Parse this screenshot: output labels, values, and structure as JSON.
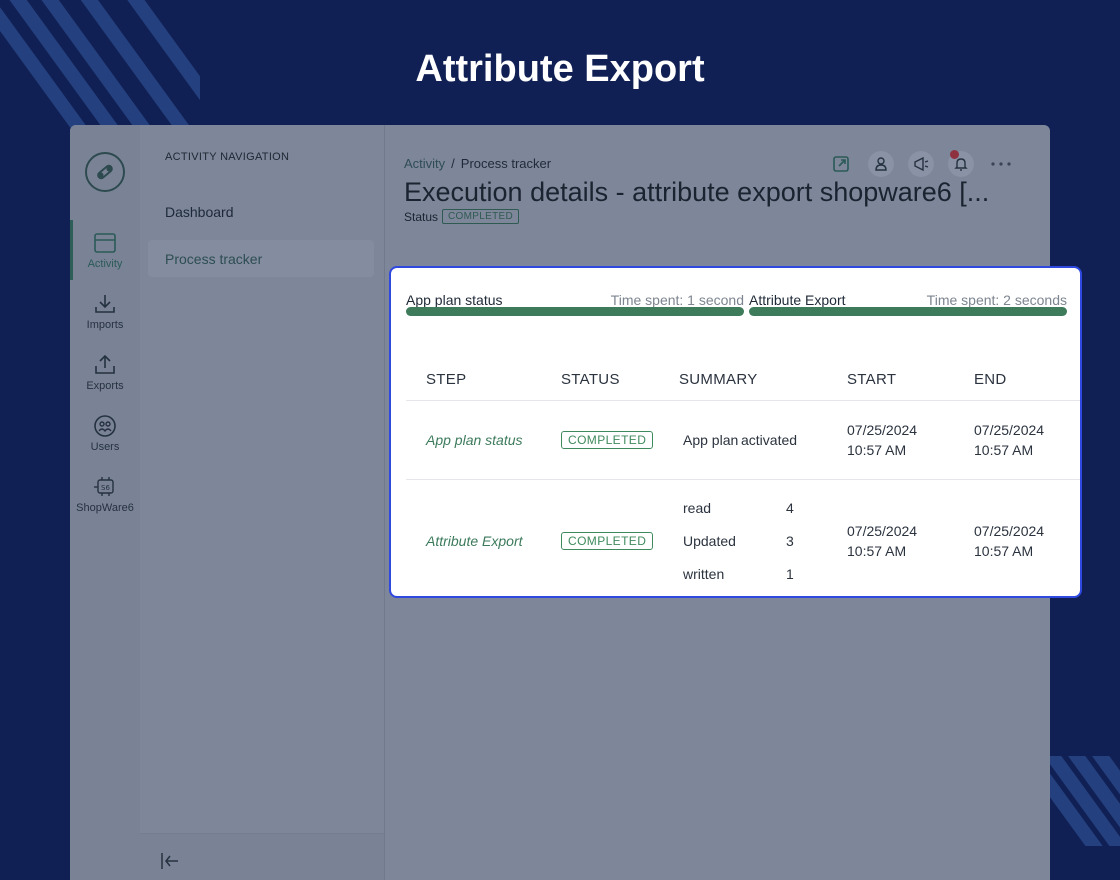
{
  "hero": {
    "title": "Attribute Export"
  },
  "rail": {
    "items": [
      {
        "label": "Activity",
        "icon": "calendar-window-icon"
      },
      {
        "label": "Imports",
        "icon": "download-icon"
      },
      {
        "label": "Exports",
        "icon": "upload-icon"
      },
      {
        "label": "Users",
        "icon": "users-icon"
      },
      {
        "label": "ShopWare6",
        "icon": "shopware-icon"
      }
    ]
  },
  "nav": {
    "heading": "ACTIVITY NAVIGATION",
    "items": [
      {
        "label": "Dashboard"
      },
      {
        "label": "Process tracker"
      }
    ]
  },
  "breadcrumb": {
    "root": "Activity",
    "separator": "/",
    "current": "Process tracker"
  },
  "page": {
    "title": "Execution details - attribute export shopware6 [...",
    "status_label": "Status",
    "status_value": "COMPLETED"
  },
  "panel": {
    "bars": [
      {
        "name": "App plan status",
        "time": "Time spent: 1 second"
      },
      {
        "name": "Attribute Export",
        "time": "Time spent: 2 seconds"
      }
    ],
    "columns": [
      "STEP",
      "STATUS",
      "SUMMARY",
      "START",
      "END"
    ],
    "rows": [
      {
        "step": "App plan status",
        "status": "COMPLETED",
        "summary_key": "App plan",
        "summary_value": "activated",
        "start_date": "07/25/2024",
        "start_time": "10:57 AM",
        "end_date": "07/25/2024",
        "end_time": "10:57 AM"
      },
      {
        "step": "Attribute Export",
        "status": "COMPLETED",
        "summary": [
          {
            "key": "read",
            "value": "4"
          },
          {
            "key": "Updated",
            "value": "3"
          },
          {
            "key": "written",
            "value": "1"
          }
        ],
        "start_date": "07/25/2024",
        "start_time": "10:57 AM",
        "end_date": "07/25/2024",
        "end_time": "10:57 AM"
      }
    ]
  },
  "colors": {
    "background": "#102054",
    "highlight_border": "#2e48e0",
    "progress_green": "#3e7b5a",
    "badge_green": "#3f8a5c"
  }
}
